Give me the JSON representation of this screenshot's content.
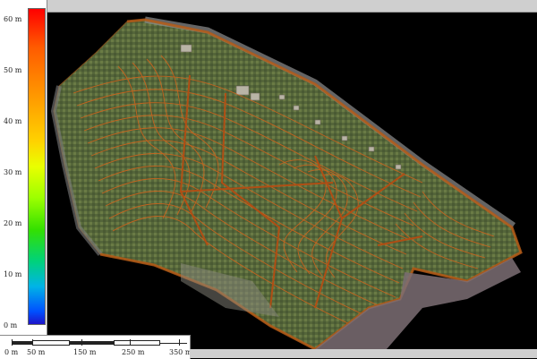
{
  "elevation_legend": {
    "unit": "m",
    "ticks": [
      "60 m",
      "50 m",
      "40 m",
      "30 m",
      "20 m",
      "10 m",
      "0 m"
    ],
    "max_color": "#ff0000",
    "min_color": "#1e14c8"
  },
  "scale_bar": {
    "labels": [
      "0 m",
      "50 m",
      "150 m",
      "250 m",
      "350 m"
    ]
  },
  "map": {
    "background_color": "#000000",
    "contour_color": "#c8641e",
    "field_color": "#5a6a38"
  }
}
